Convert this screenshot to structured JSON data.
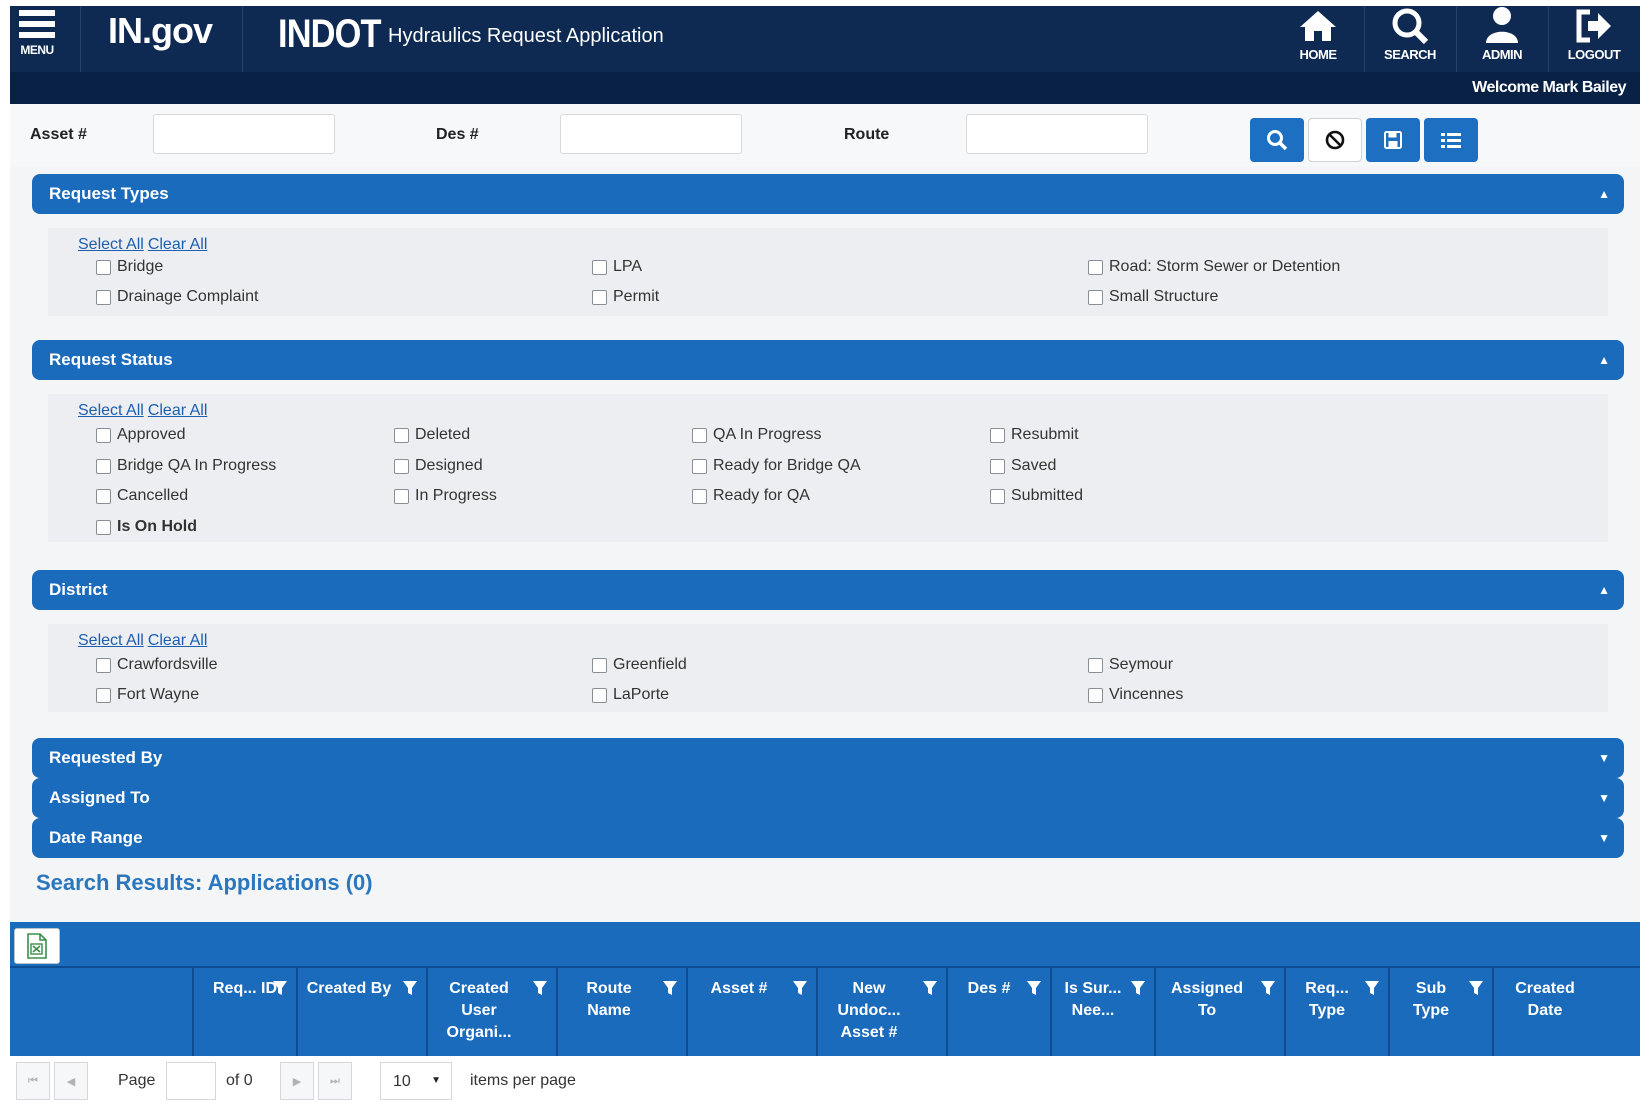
{
  "header": {
    "menu_label": "MENU",
    "ingov": "IN.gov",
    "indot": "INDOT",
    "app_title": "Hydraulics Request Application",
    "nav": [
      {
        "label": "HOME",
        "icon": "home-icon"
      },
      {
        "label": "SEARCH",
        "icon": "search-icon"
      },
      {
        "label": "ADMIN",
        "icon": "user-icon"
      },
      {
        "label": "LOGOUT",
        "icon": "logout-icon"
      }
    ],
    "welcome": "Welcome Mark Bailey"
  },
  "search": {
    "asset_label": "Asset #",
    "des_label": "Des #",
    "route_label": "Route",
    "asset_value": "",
    "des_value": "",
    "route_value": ""
  },
  "panels": {
    "select_all": "Select All",
    "clear_all": "Clear All",
    "request_types": {
      "title": "Request Types",
      "options": [
        "Bridge",
        "Drainage Complaint",
        "LPA",
        "Permit",
        "Road: Storm Sewer or Detention",
        "Small Structure"
      ]
    },
    "request_status": {
      "title": "Request Status",
      "options": [
        "Approved",
        "Bridge QA In Progress",
        "Cancelled",
        "Deleted",
        "Designed",
        "In Progress",
        "QA In Progress",
        "Ready for Bridge QA",
        "Ready for QA",
        "Resubmit",
        "Saved",
        "Submitted"
      ],
      "on_hold": "Is On Hold"
    },
    "district": {
      "title": "District",
      "options": [
        "Crawfordsville",
        "Fort Wayne",
        "Greenfield",
        "LaPorte",
        "Seymour",
        "Vincennes"
      ]
    },
    "requested_by": "Requested By",
    "assigned_to": "Assigned To",
    "date_range": "Date Range"
  },
  "results": {
    "title": "Search Results:  Applications (0)",
    "columns": [
      "Req... ID",
      "Created By",
      "Created User Organi...",
      "Route Name",
      "Asset #",
      "New Undoc... Asset #",
      "Des #",
      "Is Sur... Nee...",
      "Assigned To",
      "Req... Type",
      "Sub Type",
      "Created Date"
    ],
    "pager": {
      "page_label": "Page",
      "page_value": "",
      "of_label": "of 0",
      "per_page_value": "10",
      "per_page_label": "items per page"
    }
  },
  "colors": {
    "header_bg": "#0e2a52",
    "accent": "#1b6bbd",
    "link": "#1c5fb0"
  }
}
